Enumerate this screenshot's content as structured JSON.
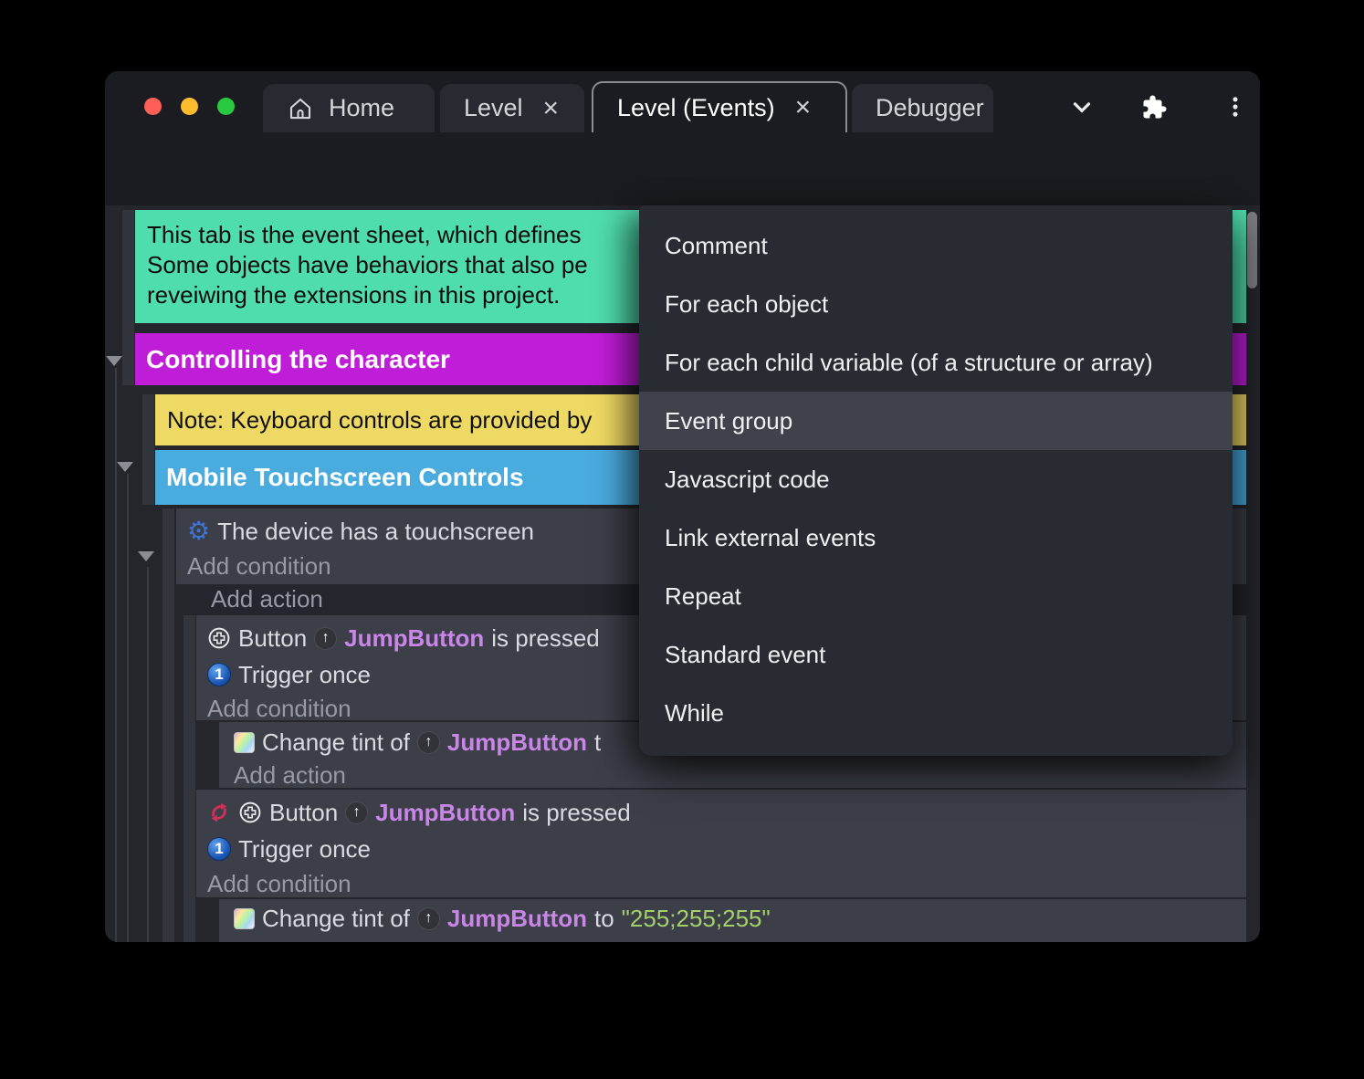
{
  "window_controls": {
    "close_color": "#ff5f57",
    "minimize_color": "#fdbc2e",
    "maximize_color": "#27c93f"
  },
  "tabs": {
    "home": "Home",
    "level": "Level",
    "level_events": "Level (Events)",
    "debugger": "Debugger",
    "close_glyph": "×"
  },
  "event_sheet": {
    "comment_lines": [
      "This tab is the event sheet, which defines",
      "Some objects have behaviors that also pe",
      "reveiwing the extensions in this project."
    ],
    "group_controlling": "Controlling the character",
    "note": "Note: Keyboard controls are provided by",
    "group_mobile": "Mobile Touchscreen Controls",
    "labels": {
      "device_touchscreen": "The device has a touchscreen",
      "add_condition": "Add condition",
      "add_action": "Add action",
      "button": "Button",
      "is_pressed": "is pressed",
      "trigger_once": "Trigger once",
      "change_tint_of": "Change tint of",
      "to": "to",
      "to_partial": "t",
      "up_arrow_glyph": "↑",
      "once_glyph": "1",
      "gear_glyph": "⚙"
    },
    "object_name": "JumpButton",
    "tint_value": "\"255;255;255\""
  },
  "context_menu": {
    "items": [
      "Comment",
      "For each object",
      "For each child variable (of a structure or array)",
      "Event group",
      "Javascript code",
      "Link external events",
      "Repeat",
      "Standard event",
      "While"
    ],
    "highlighted_item": "Event group"
  },
  "colors": {
    "window_bg": "#1b1c21",
    "sheet_bg": "#25262c",
    "event_row_bg": "#3c3f48",
    "add_action_row_bg": "#24262d",
    "menu_bg": "#292b33",
    "menu_highlight": "#3f424b",
    "comment_green": "#50ddae",
    "group_magenta": "#c01dd8",
    "note_yellow": "#eed964",
    "group_blue": "#4aabdf",
    "object_purple": "#c985e8",
    "string_green": "#a3cf6d",
    "run_button_purple": "#5633dd",
    "invert_red": "#d23059"
  }
}
